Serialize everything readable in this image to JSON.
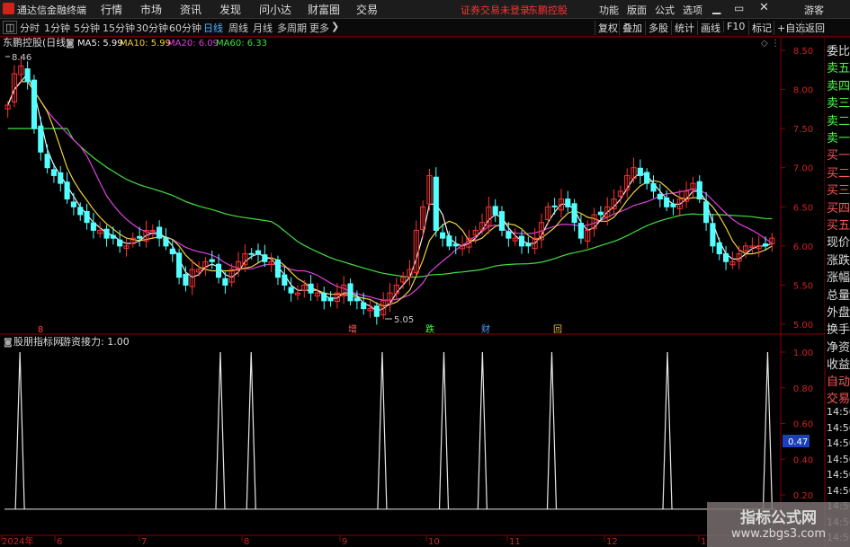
{
  "app": {
    "name": "通达信金融终端"
  },
  "menu": {
    "items": [
      "行情",
      "市场",
      "资讯",
      "发现",
      "问小达",
      "财富圈",
      "交易"
    ],
    "login_notice": "证券交易未登录",
    "stock_title": "东鹏控股",
    "right_items": [
      "功能",
      "版面",
      "公式",
      "选项"
    ],
    "guest": "游客"
  },
  "toolbar": {
    "periods": [
      "分时",
      "1分钟",
      "5分钟",
      "15分钟",
      "30分钟",
      "60分钟",
      "日线",
      "周线",
      "月线",
      "多周期",
      "更多"
    ],
    "active_period": "日线",
    "right_buttons": [
      "复权",
      "叠加",
      "多股",
      "统计",
      "画线",
      "F10",
      "标记",
      "+自选",
      "返回"
    ]
  },
  "price_chart": {
    "title": "东鹏控股(日线)",
    "ma_legend": [
      {
        "label": "MA5: 5.99",
        "color": "#f0f0f0"
      },
      {
        "label": "MA10: 5.99",
        "color": "#f0d040"
      },
      {
        "label": "MA20: 6.09",
        "color": "#e040e0"
      },
      {
        "label": "MA60: 6.33",
        "color": "#40e040"
      }
    ],
    "high_label": "8.46",
    "low_label": "5.05",
    "event_marks": [
      {
        "text": "8",
        "color": "#ff4040",
        "x": 45
      },
      {
        "text": "增",
        "color": "#ff6060",
        "x": 392
      },
      {
        "text": "跌",
        "color": "#40ff40",
        "x": 478
      },
      {
        "text": "财",
        "color": "#4aa0ff",
        "x": 540
      },
      {
        "text": "回",
        "color": "#e0c040",
        "x": 620
      }
    ]
  },
  "indicator": {
    "title": "股朋指标网",
    "value_label": "游资接力: 1.00",
    "cursor_value": "0.47"
  },
  "right_panel": {
    "items": [
      {
        "label": "委比",
        "color": "white"
      },
      {
        "label": "卖五",
        "color": "green"
      },
      {
        "label": "卖四",
        "color": "green"
      },
      {
        "label": "卖三",
        "color": "green"
      },
      {
        "label": "卖二",
        "color": "green"
      },
      {
        "label": "卖一",
        "color": "green"
      },
      {
        "label": "买一",
        "color": "red"
      },
      {
        "label": "买二",
        "color": "red"
      },
      {
        "label": "买三",
        "color": "red"
      },
      {
        "label": "买四",
        "color": "red"
      },
      {
        "label": "买五",
        "color": "red"
      },
      {
        "label": "现价",
        "color": "white"
      },
      {
        "label": "涨跌",
        "color": "white"
      },
      {
        "label": "涨幅",
        "color": "white"
      },
      {
        "label": "总量",
        "color": "white"
      },
      {
        "label": "外盘",
        "color": "white"
      },
      {
        "label": "换手",
        "color": "white"
      },
      {
        "label": "净资",
        "color": "white"
      },
      {
        "label": "收益",
        "color": "white"
      }
    ],
    "lower": [
      "自动",
      "交易",
      "14:56",
      "14:56",
      "14:56",
      "14:56",
      "14:56",
      "14:56",
      "14:56",
      "14:56",
      "14:56"
    ]
  },
  "x_axis": {
    "labels": [
      "2024年",
      "6",
      "7",
      "8",
      "9",
      "10",
      "11",
      "12",
      "1"
    ]
  },
  "watermark": {
    "line1": "指标公式网",
    "line2": "www.zbgs3.com"
  },
  "chart_data": [
    {
      "type": "candlestick",
      "title": "东鹏控股(日线)",
      "y_ticks": [
        8.5,
        8.0,
        7.5,
        7.0,
        6.5,
        6.0,
        5.5,
        5.0
      ],
      "ylim": [
        4.9,
        8.6
      ],
      "x_tick_labels": [
        "2024年",
        "6",
        "7",
        "8",
        "9",
        "10",
        "11",
        "12",
        "1"
      ],
      "series": [
        {
          "name": "MA5",
          "last": 5.99
        },
        {
          "name": "MA10",
          "last": 5.99
        },
        {
          "name": "MA20",
          "last": 6.09
        },
        {
          "name": "MA60",
          "last": 6.33
        }
      ],
      "closes": [
        7.8,
        8.2,
        8.3,
        8.1,
        7.5,
        7.2,
        7.0,
        6.9,
        6.8,
        6.6,
        6.5,
        6.4,
        6.3,
        6.2,
        6.2,
        6.1,
        6.1,
        6.0,
        6.0,
        6.1,
        6.1,
        6.2,
        6.2,
        6.1,
        6.0,
        5.9,
        5.6,
        5.5,
        5.7,
        5.7,
        5.8,
        5.8,
        5.6,
        5.5,
        5.7,
        5.8,
        5.9,
        5.9,
        5.9,
        5.8,
        5.8,
        5.6,
        5.5,
        5.4,
        5.4,
        5.5,
        5.4,
        5.4,
        5.3,
        5.3,
        5.4,
        5.5,
        5.3,
        5.3,
        5.2,
        5.2,
        5.1,
        5.3,
        5.4,
        5.5,
        5.6,
        5.7,
        6.2,
        6.5,
        6.9,
        6.2,
        6.1,
        6.0,
        6.0,
        6.0,
        6.1,
        6.2,
        6.3,
        6.5,
        6.4,
        6.2,
        6.1,
        6.1,
        6.0,
        6.0,
        6.1,
        6.3,
        6.5,
        6.5,
        6.6,
        6.5,
        6.3,
        6.1,
        6.2,
        6.4,
        6.4,
        6.5,
        6.6,
        6.7,
        6.9,
        7.0,
        6.9,
        6.8,
        6.7,
        6.6,
        6.5,
        6.5,
        6.6,
        6.7,
        6.8,
        6.6,
        6.3,
        6.0,
        5.9,
        5.8,
        5.8,
        5.9,
        6.0,
        6.0,
        6.0,
        6.0,
        6.1
      ]
    },
    {
      "type": "line",
      "title": "股朋指标网",
      "series": [
        {
          "name": "游资接力",
          "last": 1.0
        }
      ],
      "y_ticks": [
        1.0,
        0.8,
        0.6,
        0.4,
        0.2
      ],
      "ylim": [
        0.12,
        1.08
      ],
      "cursor_value": 0.47,
      "spikes_at_month_fraction": [
        0.02,
        0.28,
        0.32,
        0.49,
        0.57,
        0.62,
        0.71,
        0.86,
        0.99
      ]
    }
  ]
}
